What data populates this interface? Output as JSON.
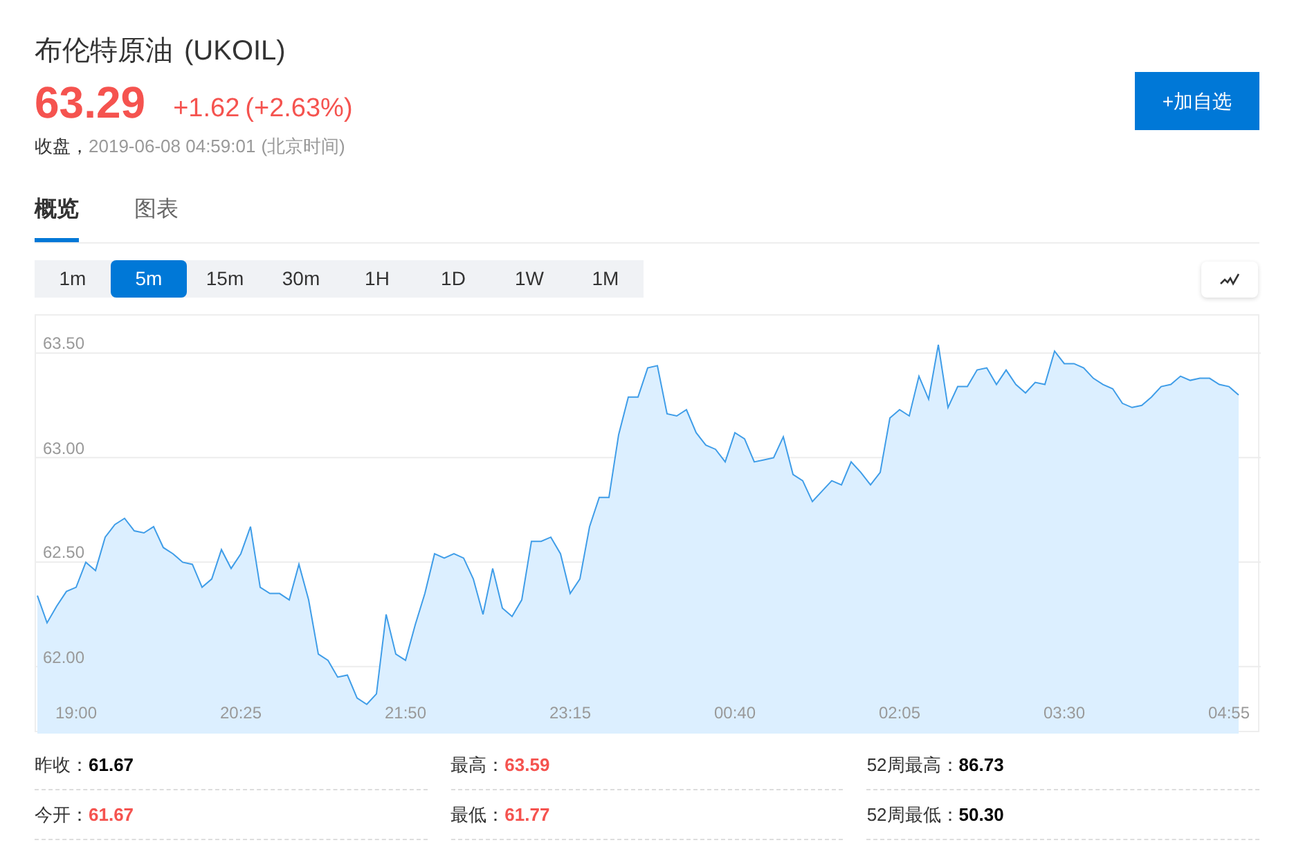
{
  "quote": {
    "name": "布伦特原油",
    "symbol": "(UKOIL)",
    "price": "63.29",
    "change": "+1.62",
    "change_percent": "(+2.63%)",
    "status": "收盘，",
    "time": "2019-06-08 04:59:01",
    "timezone": "(北京时间)"
  },
  "watch_button": {
    "label": "+加自选"
  },
  "tabs": [
    {
      "label": "概览",
      "selected": true
    },
    {
      "label": "图表",
      "selected": false
    }
  ],
  "intervals": [
    {
      "label": "1m",
      "selected": false
    },
    {
      "label": "5m",
      "selected": true
    },
    {
      "label": "15m",
      "selected": false
    },
    {
      "label": "30m",
      "selected": false
    },
    {
      "label": "1H",
      "selected": false
    },
    {
      "label": "1D",
      "selected": false
    },
    {
      "label": "1W",
      "selected": false
    },
    {
      "label": "1M",
      "selected": false
    }
  ],
  "chart_toggle": {
    "on": false
  },
  "chart": {
    "chart_data": {
      "type": "area",
      "grid": true,
      "ylim": [
        61.68,
        63.68
      ],
      "categories": [
        null,
        null,
        null,
        null,
        "19:00",
        null,
        null,
        null,
        null,
        null,
        null,
        null,
        null,
        null,
        null,
        null,
        null,
        null,
        null,
        null,
        null,
        "20:25",
        null,
        null,
        null,
        null,
        null,
        null,
        null,
        null,
        null,
        null,
        null,
        null,
        null,
        null,
        null,
        null,
        "21:50",
        null,
        null,
        null,
        null,
        null,
        null,
        null,
        null,
        null,
        null,
        null,
        null,
        null,
        null,
        null,
        null,
        "23:15",
        null,
        null,
        null,
        null,
        null,
        null,
        null,
        null,
        null,
        null,
        null,
        null,
        null,
        null,
        null,
        null,
        "00:40",
        null,
        null,
        null,
        null,
        null,
        null,
        null,
        null,
        null,
        null,
        null,
        null,
        null,
        null,
        null,
        null,
        "02:05",
        null,
        null,
        null,
        null,
        null,
        null,
        null,
        null,
        null,
        null,
        null,
        null,
        null,
        null,
        null,
        null,
        "03:30",
        null,
        null,
        null,
        null,
        null,
        null,
        null,
        null,
        null,
        null,
        null,
        null,
        null,
        null,
        null,
        null,
        "04:55",
        null
      ],
      "yticks": [
        {
          "value": 62,
          "label": "62.00"
        },
        {
          "value": 62.5,
          "label": "62.50"
        },
        {
          "value": 63,
          "label": "63.00"
        },
        {
          "value": 63.5,
          "label": "63.50"
        }
      ],
      "series": [
        {
          "color": "#3f9de8",
          "values": [
            62.34,
            62.21,
            62.29,
            62.36,
            62.38,
            62.5,
            62.46,
            62.62,
            62.68,
            62.71,
            62.65,
            62.64,
            62.67,
            62.57,
            62.54,
            62.5,
            62.49,
            62.38,
            62.42,
            62.56,
            62.47,
            62.54,
            62.67,
            62.38,
            62.35,
            62.35,
            62.32,
            62.49,
            62.32,
            62.06,
            62.03,
            61.95,
            61.96,
            61.85,
            61.82,
            61.87,
            62.25,
            62.06,
            62.03,
            62.2,
            62.35,
            62.54,
            62.52,
            62.54,
            62.52,
            62.42,
            62.25,
            62.47,
            62.28,
            62.24,
            62.32,
            62.6,
            62.6,
            62.62,
            62.54,
            62.35,
            62.42,
            62.67,
            62.81,
            62.81,
            63.11,
            63.29,
            63.29,
            63.43,
            63.44,
            63.21,
            63.2,
            63.23,
            63.12,
            63.06,
            63.04,
            62.98,
            63.12,
            63.09,
            62.98,
            62.99,
            63.0,
            63.1,
            62.92,
            62.89,
            62.79,
            62.84,
            62.89,
            62.87,
            62.98,
            62.93,
            62.87,
            62.93,
            63.19,
            63.23,
            63.2,
            63.39,
            63.28,
            63.54,
            63.24,
            63.34,
            63.34,
            63.42,
            63.43,
            63.35,
            63.42,
            63.35,
            63.31,
            63.36,
            63.35,
            63.51,
            63.45,
            63.45,
            63.43,
            63.38,
            63.35,
            63.33,
            63.26,
            63.24,
            63.25,
            63.29,
            63.34,
            63.35,
            63.39,
            63.37,
            63.38,
            63.38,
            63.35,
            63.34,
            63.3
          ]
        }
      ]
    }
  },
  "stats": [
    {
      "label": "昨收：",
      "value": "61.67",
      "color": "#000000"
    },
    {
      "label": "最高：",
      "value": "63.59",
      "color": "#f5534f"
    },
    {
      "label": "52周最高：",
      "value": "86.73",
      "color": "#000000"
    },
    {
      "label": "今开：",
      "value": "61.67",
      "color": "#f5534f"
    },
    {
      "label": "最低：",
      "value": "61.77",
      "color": "#f5534f"
    },
    {
      "label": "52周最低：",
      "value": "50.30",
      "color": "#000000"
    }
  ]
}
